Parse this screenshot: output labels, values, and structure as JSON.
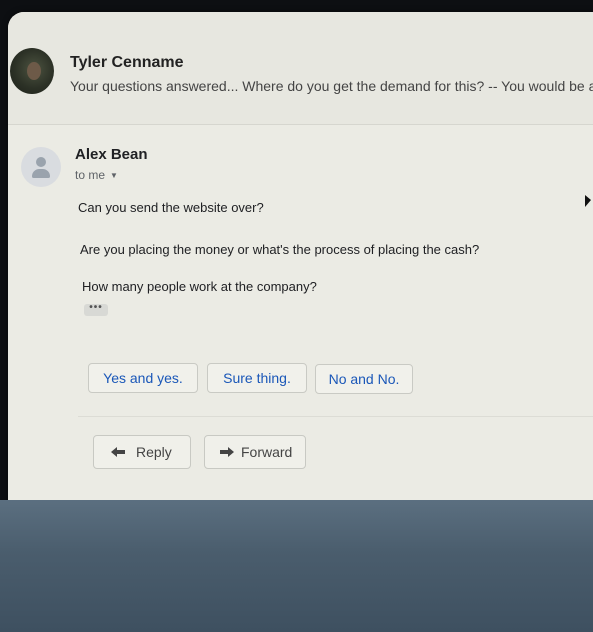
{
  "thread": {
    "collapsed_sender": "Tyler Cenname",
    "collapsed_snippet": "Your questions answered... Where do you get the demand for this? -- You would be a"
  },
  "message": {
    "sender": "Alex Bean",
    "recipient": "to me",
    "body_lines": [
      "Can you send the website over?",
      "Are you placing the money or what's the process of placing the cash?",
      "How many people work at the company?"
    ],
    "trimmed_content": "•••"
  },
  "smart_replies": [
    "Yes and yes.",
    "Sure thing.",
    "No and No."
  ],
  "actions": {
    "reply_label": "Reply",
    "forward_label": "Forward"
  },
  "icons": {
    "reply": "reply-arrow-icon",
    "forward": "forward-arrow-icon",
    "recipient_toggle": "caret-down-icon",
    "avatar_placeholder": "person-icon"
  },
  "colors": {
    "smart_reply_text": "#1a57b8",
    "page_background": "#ebebe4"
  }
}
